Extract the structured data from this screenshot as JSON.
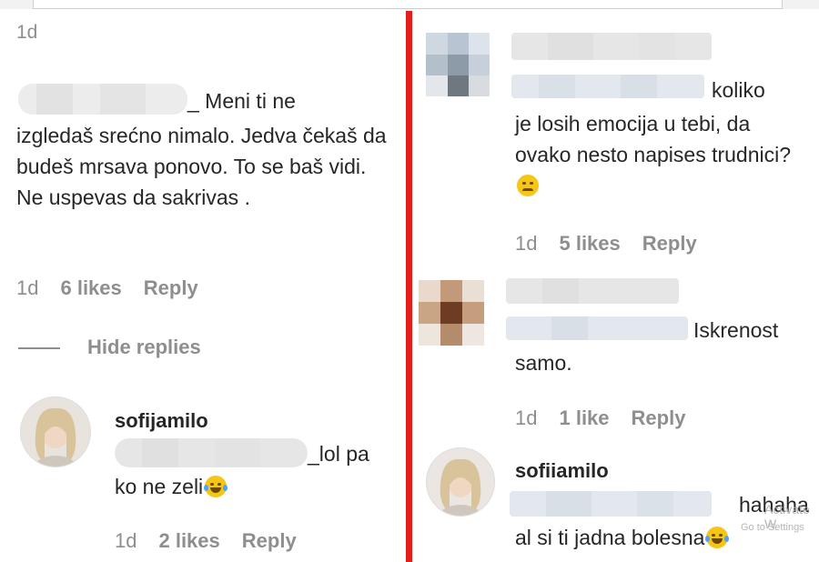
{
  "left": {
    "parent": {
      "timestamp": "1d",
      "text_line1_suffix": "_ Meni ti ne",
      "text_rest": "izgledaš srećno nimalo. Jedva čekaš da budeš mrsava ponovo. To se baš vidi. Ne uspevas da sakrivas .",
      "meta": {
        "time": "1d",
        "likes": "6 likes",
        "reply": "Reply"
      }
    },
    "hide_replies": "Hide replies",
    "reply": {
      "username": "sofijamilo",
      "text_suffix": "_lol pa",
      "text_line2": "ko ne zeli",
      "meta": {
        "time": "1d",
        "likes": "2 likes",
        "reply": "Reply"
      }
    }
  },
  "right": {
    "comment1": {
      "text_suffix": "koliko",
      "text_rest": "je losih emocija u tebi, da ovako nesto napises trudnici?",
      "meta": {
        "time": "1d",
        "likes": "5 likes",
        "reply": "Reply"
      }
    },
    "comment2": {
      "text_suffix": "Iskrenost",
      "text_line2": "samo.",
      "meta": {
        "time": "1d",
        "likes": "1 like",
        "reply": "Reply"
      }
    },
    "reply": {
      "username": "sofiiamilo",
      "text_suffix": "hahaha",
      "text_line2": "al si ti jadna bolesna"
    }
  },
  "watermark": {
    "line1": "Activate W",
    "line2": "Go to Settings"
  },
  "icons": {
    "sad": "pensive-face-icon",
    "laugh": "tears-of-joy-icon"
  },
  "colors": {
    "divider": "#e41c1c",
    "muted": "#8e8e8e",
    "text": "#262626"
  }
}
